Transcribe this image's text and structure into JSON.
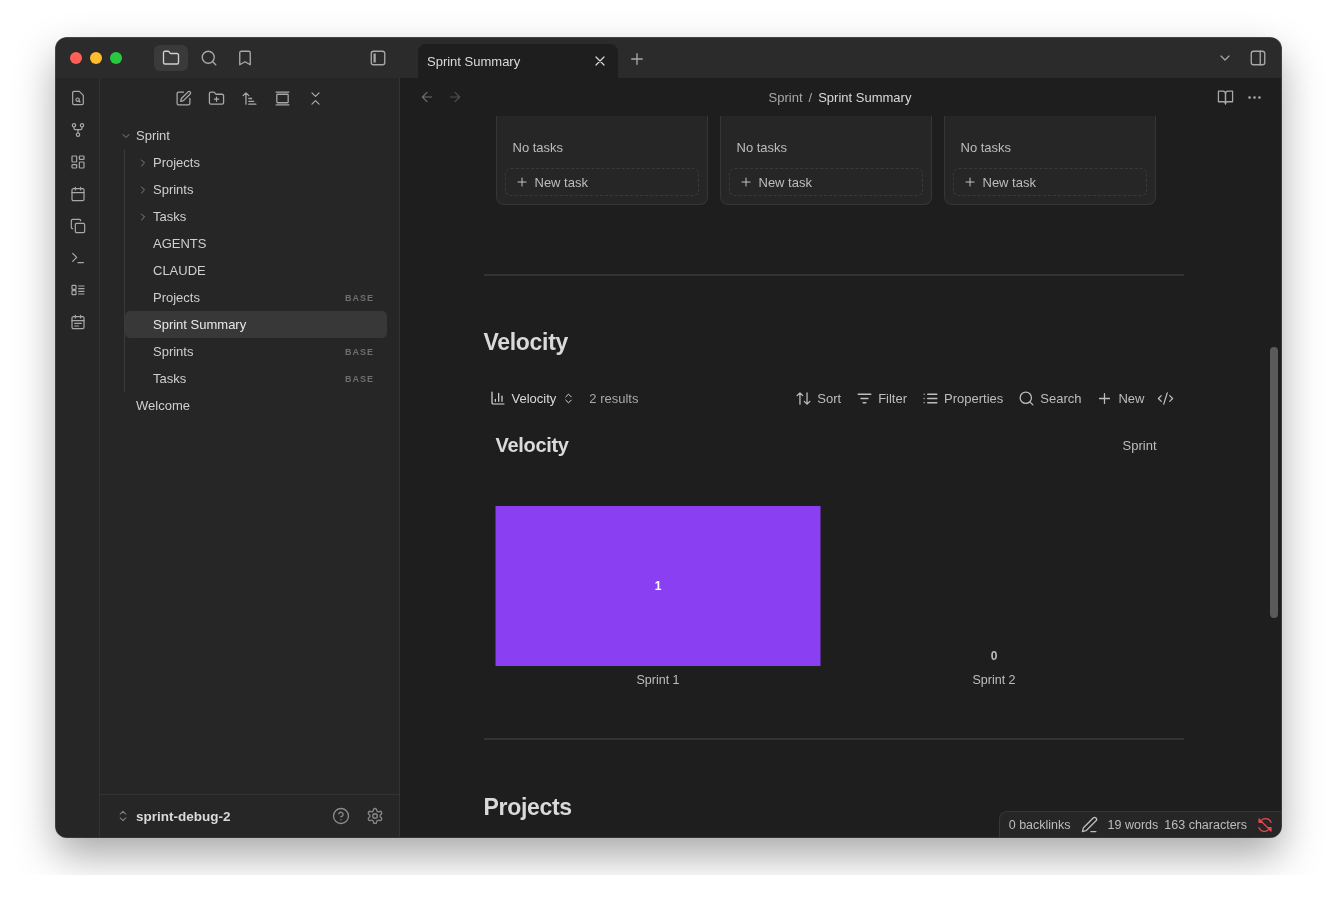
{
  "tabs": [
    {
      "label": "Sprint Summary",
      "selected": true
    }
  ],
  "breadcrumb": {
    "items": [
      "Sprint",
      "Sprint Summary"
    ],
    "separator": "/"
  },
  "file_tree": [
    {
      "label": "Sprint",
      "kind": "folder",
      "expanded": true,
      "selected": false,
      "children": [
        {
          "label": "Projects",
          "kind": "folder",
          "expanded": false,
          "selected": false
        },
        {
          "label": "Sprints",
          "kind": "folder",
          "expanded": false,
          "selected": false
        },
        {
          "label": "Tasks",
          "kind": "folder",
          "expanded": false,
          "selected": false
        },
        {
          "label": "AGENTS",
          "kind": "file",
          "selected": false
        },
        {
          "label": "CLAUDE",
          "kind": "file",
          "selected": false
        },
        {
          "label": "Projects",
          "kind": "file",
          "tag": "BASE",
          "selected": false
        },
        {
          "label": "Sprint Summary",
          "kind": "file",
          "selected": true
        },
        {
          "label": "Sprints",
          "kind": "file",
          "tag": "BASE",
          "selected": false
        },
        {
          "label": "Tasks",
          "kind": "file",
          "tag": "BASE",
          "selected": false
        }
      ]
    },
    {
      "label": "Welcome",
      "kind": "file",
      "selected": false
    }
  ],
  "vault": {
    "name": "sprint-debug-2"
  },
  "kanban": {
    "columns": [
      {
        "empty_text": "No tasks",
        "action": "New task"
      },
      {
        "empty_text": "No tasks",
        "action": "New task"
      },
      {
        "empty_text": "No tasks",
        "action": "New task"
      }
    ]
  },
  "sections": [
    {
      "kind": "base",
      "heading": "Velocity",
      "view": "Velocity",
      "results": "2 results",
      "actions": [
        {
          "kind": "sort",
          "label": "Sort"
        },
        {
          "kind": "filter",
          "label": "Filter"
        },
        {
          "kind": "properties",
          "label": "Properties"
        },
        {
          "kind": "search",
          "label": "Search"
        },
        {
          "kind": "new",
          "label": "New"
        }
      ],
      "chart": {
        "title": "Velocity",
        "chart_data": {
          "type": "bar",
          "categories": [
            "Sprint 1",
            "Sprint 2"
          ],
          "series": [
            {
              "name": "Sprint",
              "color": "#8b3ff2",
              "values": [
                1,
                0
              ]
            }
          ],
          "ylim": [
            0,
            1
          ],
          "data_labels": true
        }
      }
    },
    {
      "kind": "heading",
      "heading": "Projects"
    }
  ],
  "status_bar": {
    "backlinks": "0 backlinks",
    "words": "19 words",
    "characters": "163 characters"
  }
}
